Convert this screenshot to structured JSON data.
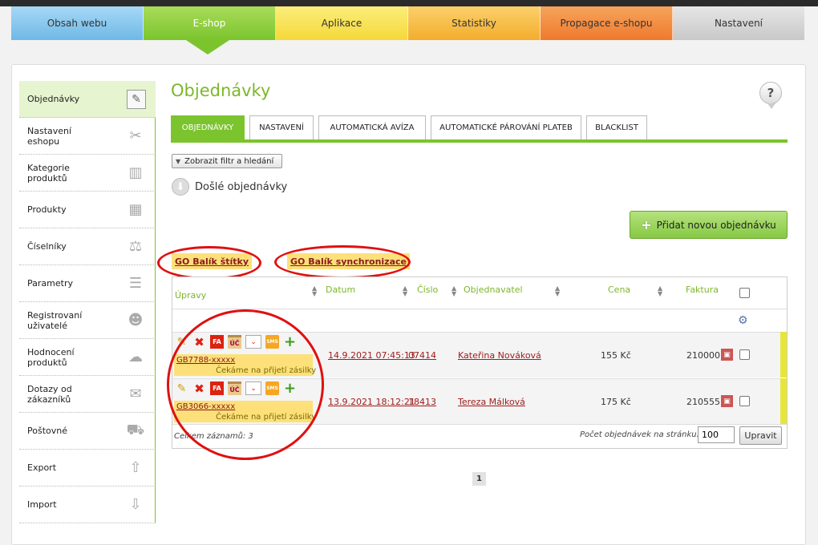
{
  "top_nav": [
    {
      "label": "Obsah webu"
    },
    {
      "label": "E-shop"
    },
    {
      "label": "Aplikace"
    },
    {
      "label": "Statistiky"
    },
    {
      "label": "Propagace e-shopu"
    },
    {
      "label": "Nastavení"
    }
  ],
  "sidebar": {
    "items": [
      {
        "label": "Objednávky",
        "icon": "clipboard-icon",
        "glyph": "✎"
      },
      {
        "label": "Nastavení eshopu",
        "icon": "tools-icon",
        "glyph": "✂"
      },
      {
        "label": "Kategorie produktů",
        "icon": "map-icon",
        "glyph": "▥"
      },
      {
        "label": "Produkty",
        "icon": "boxes-icon",
        "glyph": "▦"
      },
      {
        "label": "Číselníky",
        "icon": "weights-icon",
        "glyph": "⚖"
      },
      {
        "label": "Parametry",
        "icon": "sliders-icon",
        "glyph": "☰"
      },
      {
        "label": "Registrovaní uživatelé",
        "icon": "users-icon",
        "glyph": "☻"
      },
      {
        "label": "Hodnocení produktů",
        "icon": "rating-icon",
        "glyph": "☁"
      },
      {
        "label": "Dotazy od zákazníků",
        "icon": "chat-icon",
        "glyph": "✉"
      },
      {
        "label": "Poštovné",
        "icon": "truck-icon",
        "glyph": "⛟"
      },
      {
        "label": "Export",
        "icon": "export-icon",
        "glyph": "⇧"
      },
      {
        "label": "Import",
        "icon": "import-icon",
        "glyph": "⇩"
      }
    ]
  },
  "page_title": "Objednávky",
  "help_label": "?",
  "tabs": [
    {
      "label": "OBJEDNÁVKY"
    },
    {
      "label": "NASTAVENÍ"
    },
    {
      "label": "AUTOMATICKÁ AVÍZA"
    },
    {
      "label": "AUTOMATICKÉ PÁROVÁNÍ PLATEB"
    },
    {
      "label": "BLACKLIST"
    }
  ],
  "filter_button": "Zobrazit filtr a hledání",
  "incoming_label": "Došlé objednávky",
  "add_order_button": "Přidat novou objednávku",
  "go_links": [
    "GO Balík štítky",
    "GO Balík synchronizace"
  ],
  "table": {
    "headers": [
      "Úpravy",
      "Datum",
      "Číslo",
      "Objednavatel",
      "Cena",
      "Faktura"
    ],
    "icons": {
      "fa": "FA",
      "uc": "ÚČ",
      "sms": "SMS",
      "select": "⌄"
    },
    "rows": [
      {
        "tracking": "GB7788-xxxxx",
        "status": "Čekáme na přijetí zásilky",
        "date": "14.9.2021 07:45:13",
        "number": "07414",
        "customer": "Kateřina Nováková",
        "price": "155 Kč",
        "invoice": "210000"
      },
      {
        "tracking": "GB3066-xxxxx",
        "status": "Čekáme na přijetí zásilky",
        "date": "13.9.2021 18:12:21",
        "number": "18413",
        "customer": "Tereza Málková",
        "price": "175 Kč",
        "invoice": "210555"
      }
    ],
    "total_label": "Celkem záznamů: 3",
    "per_page_label": "Počet objednávek na stránku:",
    "per_page_value": "100",
    "apply_button": "Upravit"
  },
  "pager": {
    "current_page": "1"
  }
}
